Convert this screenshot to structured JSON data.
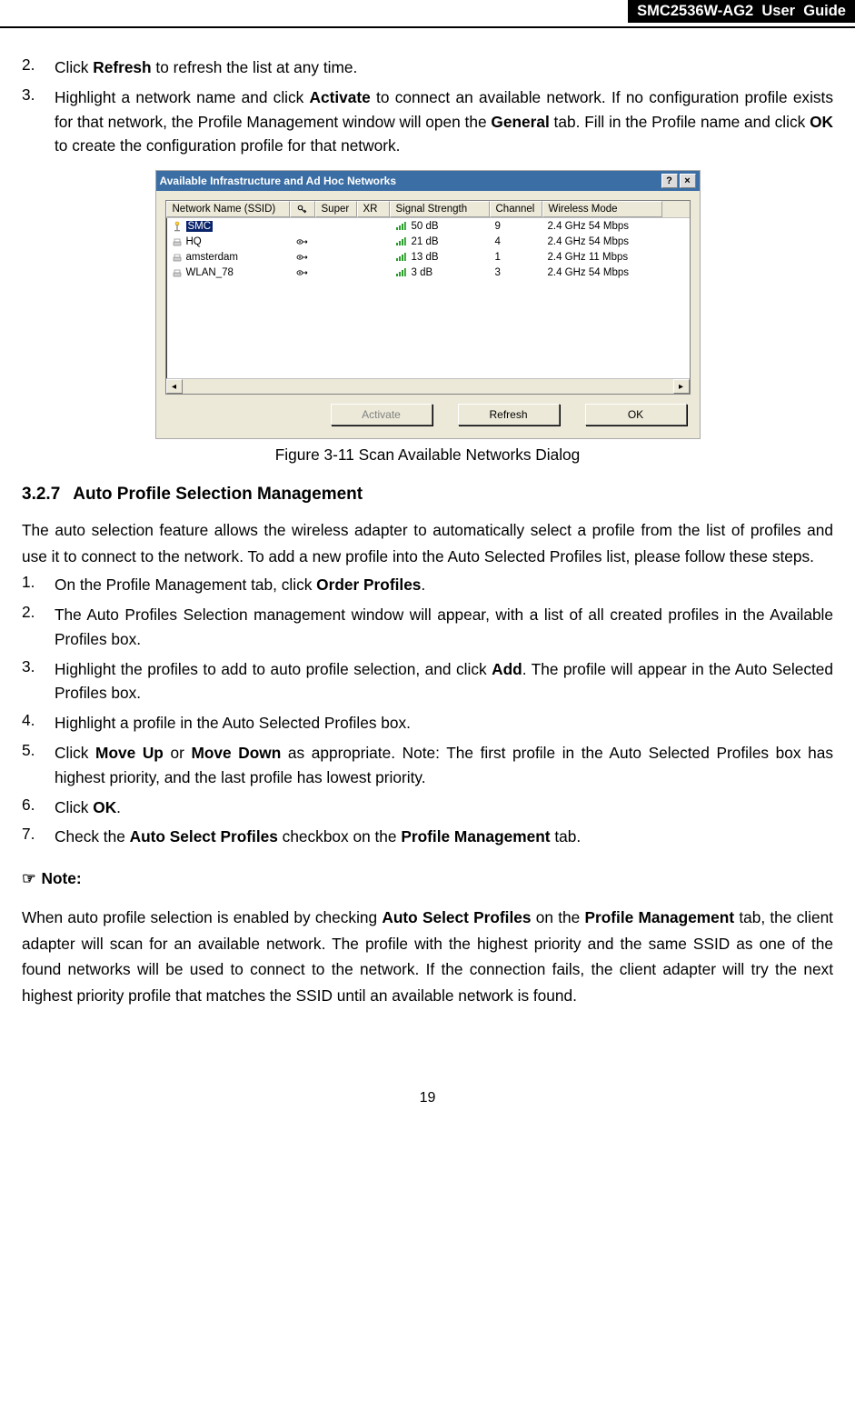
{
  "header": {
    "label": "SMC2536W-AG2  User  Guide"
  },
  "list_top": [
    {
      "num": "2.",
      "segments": [
        {
          "t": "Click "
        },
        {
          "t": "Refresh",
          "b": true
        },
        {
          "t": " to refresh the list at any time."
        }
      ]
    },
    {
      "num": "3.",
      "segments": [
        {
          "t": "Highlight a network name and click "
        },
        {
          "t": "Activate",
          "b": true
        },
        {
          "t": " to connect an available network. If no configuration profile exists for that network, the Profile Management window will open the "
        },
        {
          "t": "General",
          "b": true
        },
        {
          "t": " tab. Fill in the Profile name and click "
        },
        {
          "t": "OK",
          "b": true
        },
        {
          "t": " to create the configuration profile for that network."
        }
      ]
    }
  ],
  "figure": {
    "title": "Available Infrastructure and Ad Hoc Networks",
    "columns": [
      "Network Name (SSID)",
      "",
      "Super",
      "XR",
      "Signal Strength",
      "Channel",
      "Wireless Mode"
    ],
    "key_icon_title": "Security",
    "rows": [
      {
        "icon": "infra",
        "ssid": "SMC",
        "sec": false,
        "signal": "50 dB",
        "channel": "9",
        "mode": "2.4 GHz 54 Mbps",
        "selected": true
      },
      {
        "icon": "adhoc",
        "ssid": "HQ",
        "sec": true,
        "signal": "21 dB",
        "channel": "4",
        "mode": "2.4 GHz 54 Mbps",
        "selected": false
      },
      {
        "icon": "adhoc",
        "ssid": "amsterdam",
        "sec": true,
        "signal": "13 dB",
        "channel": "1",
        "mode": "2.4 GHz 11 Mbps",
        "selected": false
      },
      {
        "icon": "adhoc",
        "ssid": "WLAN_78",
        "sec": true,
        "signal": "3 dB",
        "channel": "3",
        "mode": "2.4 GHz 54 Mbps",
        "selected": false
      }
    ],
    "buttons": {
      "activate": "Activate",
      "refresh": "Refresh",
      "ok": "OK"
    },
    "caption": "Figure 3-11 Scan Available Networks Dialog"
  },
  "section": {
    "num": "3.2.7",
    "title": "Auto Profile Selection Management"
  },
  "section_intro": "The auto selection feature allows the wireless adapter to automatically select a profile from the list of profiles and use it to connect to the network. To add a new profile into the Auto Selected Profiles list, please follow these steps.",
  "list_steps": [
    {
      "num": "1.",
      "segments": [
        {
          "t": "On the Profile Management tab, click "
        },
        {
          "t": "Order Profiles",
          "b": true
        },
        {
          "t": "."
        }
      ]
    },
    {
      "num": "2.",
      "segments": [
        {
          "t": "The Auto Profiles Selection management window will appear, with a list of all created profiles in the Available Profiles box."
        }
      ]
    },
    {
      "num": "3.",
      "segments": [
        {
          "t": "Highlight the profiles to add to auto profile selection, and click "
        },
        {
          "t": "Add",
          "b": true
        },
        {
          "t": ". The profile will appear in the Auto Selected Profiles box."
        }
      ]
    },
    {
      "num": "4.",
      "segments": [
        {
          "t": "Highlight a profile in the Auto Selected Profiles box."
        }
      ]
    },
    {
      "num": "5.",
      "segments": [
        {
          "t": "Click "
        },
        {
          "t": "Move Up",
          "b": true
        },
        {
          "t": " or "
        },
        {
          "t": "Move Down",
          "b": true
        },
        {
          "t": " as appropriate. Note: The first profile in the Auto Selected Profiles box has highest priority, and the last profile has lowest priority."
        }
      ]
    },
    {
      "num": "6.",
      "segments": [
        {
          "t": "Click "
        },
        {
          "t": "OK",
          "b": true
        },
        {
          "t": "."
        }
      ]
    },
    {
      "num": "7.",
      "segments": [
        {
          "t": "Check the "
        },
        {
          "t": "Auto Select Profiles",
          "b": true
        },
        {
          "t": " checkbox on the "
        },
        {
          "t": "Profile Management",
          "b": true
        },
        {
          "t": " tab."
        }
      ]
    }
  ],
  "note_label": "Note:",
  "note_body_segments": [
    {
      "t": "When auto profile selection is enabled by checking "
    },
    {
      "t": "Auto Select Profiles",
      "b": true
    },
    {
      "t": " on the "
    },
    {
      "t": "Profile Management",
      "b": true
    },
    {
      "t": " tab, the client adapter will scan for an available network. The profile with the highest priority and the same SSID as one of the found networks will be used to connect to the network. If the connection fails, the client adapter will try the next highest priority profile that matches the SSID until an available network is found."
    }
  ],
  "page_number": "19"
}
